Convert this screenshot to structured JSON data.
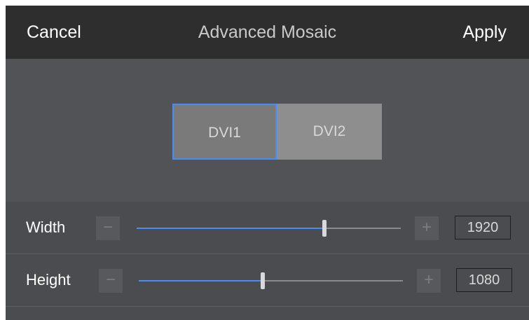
{
  "header": {
    "cancel_label": "Cancel",
    "title": "Advanced Mosaic",
    "apply_label": "Apply"
  },
  "mosaic": {
    "tiles": [
      {
        "label": "DVI1",
        "selected": true
      },
      {
        "label": "DVI2",
        "selected": false
      }
    ]
  },
  "settings": {
    "width": {
      "label": "Width",
      "value": "1920",
      "slider_fraction": 0.71,
      "minus_icon": "minus-icon",
      "plus_icon": "plus-icon"
    },
    "height": {
      "label": "Height",
      "value": "1080",
      "slider_fraction": 0.47,
      "minus_icon": "minus-icon",
      "plus_icon": "plus-icon"
    }
  },
  "colors": {
    "accent": "#4a8cf7",
    "header_bg": "#2e2e2e",
    "panel_bg": "#4b4c4f"
  }
}
